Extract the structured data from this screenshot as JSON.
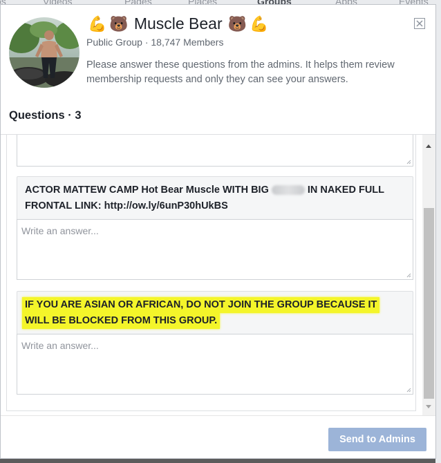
{
  "background": {
    "nav_items": [
      {
        "label": "Videos",
        "bold": false
      },
      {
        "label": "Pages",
        "bold": false
      },
      {
        "label": "Places",
        "bold": false
      },
      {
        "label": "Groups",
        "bold": true
      },
      {
        "label": "Apps",
        "bold": false
      },
      {
        "label": "Events",
        "bold": false
      }
    ]
  },
  "dialog": {
    "group": {
      "name": "Muscle Bear",
      "title_emoji_left": [
        "💪",
        "🐻"
      ],
      "title_emoji_right": [
        "🐻",
        "💪"
      ],
      "privacy": "Public Group",
      "separator": "·",
      "members": "18,747 Members"
    },
    "description": "Please answer these questions from the admins. It helps them review membership requests and only they can see your answers.",
    "questions_label": "Questions",
    "questions_count": "3",
    "questions": [
      {
        "text_before": "ACTOR MATTEW CAMP Hot Bear Muscle WITH BIG",
        "text_after": "IN NAKED FULL",
        "line2": "FRONTAL LINK: http://ow.ly/6unP30hUkBS",
        "answer_placeholder": "Write an answer..."
      },
      {
        "line1": "IF YOU ARE ASIAN OR AFRICAN, DO NOT JOIN THE GROUP BECAUSE IT",
        "line2": "WILL BE BLOCKED FROM THIS GROUP.",
        "highlight_color": "#f4f52a",
        "answer_placeholder": "Write an answer..."
      }
    ],
    "send_button": "Send to Admins",
    "colors": {
      "send_button_bg": "#9cb4d8",
      "highlight": "#f4f52a"
    }
  }
}
